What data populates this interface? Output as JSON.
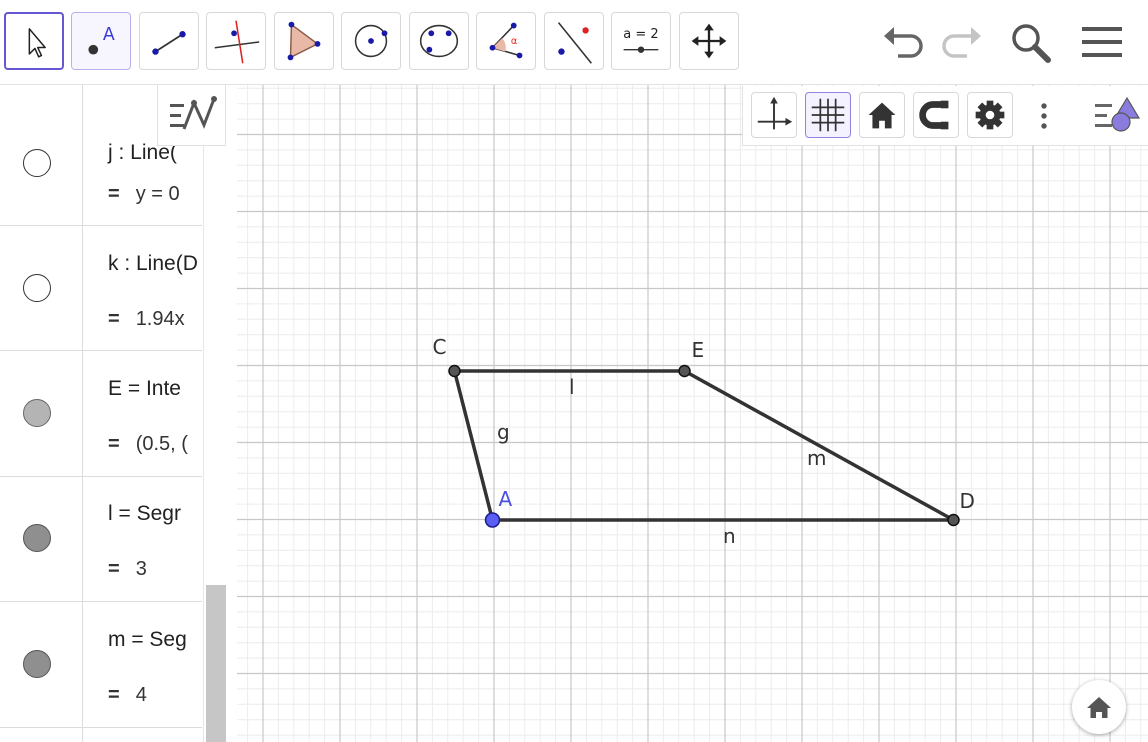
{
  "toolbar": {
    "tools": [
      {
        "name": "move-tool-icon",
        "active": true
      },
      {
        "name": "point-tool-icon",
        "label": "A",
        "selected": true
      },
      {
        "name": "segment-tool-icon"
      },
      {
        "name": "perpendicular-line-tool-icon"
      },
      {
        "name": "polygon-tool-icon"
      },
      {
        "name": "circle-tool-icon"
      },
      {
        "name": "conic-tool-icon"
      },
      {
        "name": "angle-tool-icon",
        "label": "α"
      },
      {
        "name": "reflect-tool-icon"
      },
      {
        "name": "slider-tool-icon",
        "label": "a = 2"
      },
      {
        "name": "move-graphics-view-tool-icon"
      }
    ],
    "right": [
      "undo-icon",
      "redo-icon",
      "search-icon",
      "menu-icon"
    ]
  },
  "algebra": {
    "rows": [
      {
        "def": "j : Line(",
        "value": "y = 0",
        "marble": "off"
      },
      {
        "def": "k : Line(D",
        "value": "1.94x",
        "marble": "off"
      },
      {
        "def": "E = Inte",
        "value": "(0.5, (",
        "marble": "on-light"
      },
      {
        "def": "l = Segr",
        "value": "3",
        "marble": "on-dark"
      },
      {
        "def": "m = Seg",
        "value": "4",
        "marble": "on-dark"
      }
    ],
    "equals": "="
  },
  "graphics": {
    "points": [
      {
        "name": "A",
        "color": "#4a4fe6"
      },
      {
        "name": "C",
        "color": "#333333"
      },
      {
        "name": "E",
        "color": "#333333"
      },
      {
        "name": "D",
        "color": "#333333"
      }
    ],
    "segments": [
      {
        "name": "g",
        "from": "A",
        "to": "C"
      },
      {
        "name": "l",
        "from": "C",
        "to": "E"
      },
      {
        "name": "m",
        "from": "E",
        "to": "D"
      },
      {
        "name": "n",
        "from": "A",
        "to": "D"
      }
    ]
  },
  "stylebar": [
    "axes-icon",
    "grid-icon",
    "home-icon",
    "magnet-icon",
    "gear-icon",
    "more-vertical-icon",
    "style-bar-toggle-icon"
  ],
  "colors": {
    "accent": "#6557d2",
    "point_free": "#4a4fe6",
    "stroke": "#333333",
    "grid_major": "#c8c8c8",
    "grid_minor": "#ececec"
  }
}
